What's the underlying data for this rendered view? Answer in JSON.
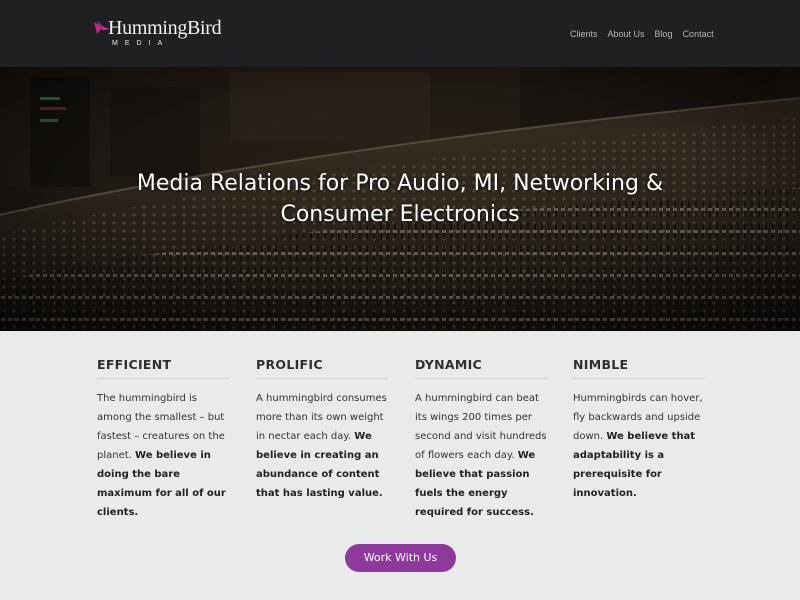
{
  "brand": {
    "name": "HummingBird",
    "sub": "MEDIA",
    "accent_color": "#8e3a9d"
  },
  "nav": {
    "items": [
      "Clients",
      "About Us",
      "Blog",
      "Contact"
    ]
  },
  "hero": {
    "title_line1": "Media Relations for Pro Audio, MI, Networking &",
    "title_line2": "Consumer Electronics"
  },
  "features": [
    {
      "heading": "EFFICIENT",
      "text": "The hummingbird is among the smallest – but fastest – creatures on the planet.",
      "bold": "We believe in doing the bare maximum for all of our clients."
    },
    {
      "heading": "PROLIFIC",
      "text": "A hummingbird consumes more than its own weight in nectar each day.",
      "bold": "We believe in creating an abundance of content that has lasting value."
    },
    {
      "heading": "DYNAMIC",
      "text": "A hummingbird can beat its wings 200 times per second and visit hundreds of flowers each day.",
      "bold": "We believe that passion fuels the energy required for success."
    },
    {
      "heading": "NIMBLE",
      "text": "Hummingbirds can hover, fly backwards and upside down.",
      "bold": "We believe that adaptability is a prerequisite for innovation."
    }
  ],
  "cta": {
    "label": "Work With Us"
  }
}
